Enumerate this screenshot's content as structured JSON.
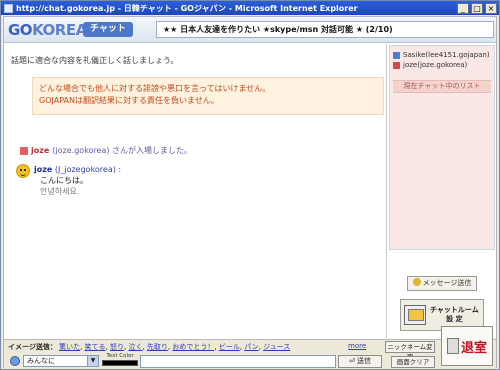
{
  "window": {
    "title": "http://chat.gokorea.jp - 日韓チャット - GOジャパン - Microsoft Internet Explorer",
    "controls": [
      "_",
      "□",
      "×"
    ]
  },
  "header": {
    "logo_go": "GO",
    "logo_korea": "KOREA",
    "tab": "チャット",
    "room_title": "★★ 日本人友達を作りたい ★skype/msn 対話可能 ★ (2/10)"
  },
  "main": {
    "guide": "話題に適合な内容を礼儀正しく話しましょう。",
    "notice_line1": "どんな場合でも他人に対する誹謗や悪口を言ってはいけません。",
    "notice_line2": "GOJAPANは翻訳結果に対する責任を負いません。",
    "entered_user": "joze",
    "entered_text": "(joze.gokorea) さんが入場しました。",
    "message": {
      "sender": "joze",
      "sender_id": "(J_jozegokorea) :",
      "line1": "こんにちは。",
      "line2": "안녕하세요."
    }
  },
  "side": {
    "users": [
      {
        "name": "Sasike(lee4151.gojapan)",
        "icon": "blue-user-icon"
      },
      {
        "name": "joze(joze.gokorea)",
        "icon": "red-user-icon"
      }
    ],
    "list_label": "現在チャット中のリスト",
    "send_message": "メッセージ送信",
    "chatroom_line1": "チャットルーム",
    "chatroom_line2": "設 定"
  },
  "bottom": {
    "emote_label": "イメージ送信：",
    "emotes": [
      "驚いた",
      "笑てる",
      "怒り",
      "泣く",
      "先取り",
      "おめでとう！",
      "ビール",
      "パン",
      "ジュース"
    ],
    "more": "more",
    "nick_change": "ニックネーム変更",
    "screen_clear": "画面クリア",
    "exit": "退室",
    "target": "みんなに",
    "color_label": "Text Color",
    "send": "送信",
    "input_value": ""
  }
}
